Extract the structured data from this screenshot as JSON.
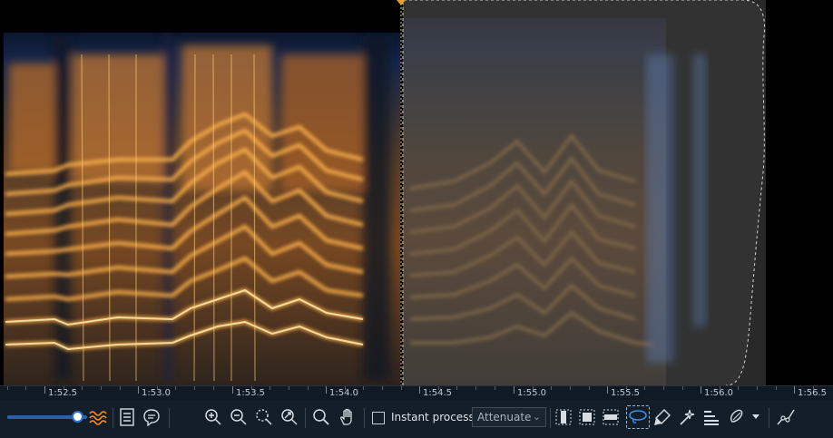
{
  "timeline": {
    "ticks": [
      "1:52.5",
      "1:53.0",
      "1:53.5",
      "1:54.0",
      "1:54.5",
      "1:55.0",
      "1:55.5",
      "1:56.0",
      "1:56.5"
    ]
  },
  "toolbar": {
    "zoom_level": 0.88,
    "instant_process_label": "Instant process",
    "instant_process_checked": false,
    "mode_select_value": "Attenuate",
    "icons": [
      "waveform-toggle-icon",
      "spectrum-list-icon",
      "comment-icon",
      "zoom-in-icon",
      "zoom-out-icon",
      "zoom-selection-icon",
      "zoom-fit-icon",
      "find-icon",
      "hand-icon",
      "time-selection-icon",
      "time-frequency-selection-icon",
      "frequency-selection-icon",
      "lasso-icon",
      "brush-icon",
      "magic-wand-icon",
      "harmonic-selection-icon",
      "paint-options-icon",
      "curve-icon"
    ]
  },
  "colors": {
    "background": "#000000",
    "panel": "#141e28",
    "accent": "#2b6fd0",
    "spectrogram_hot": "#ffcf6a",
    "spectrogram_cool": "#1b2d59",
    "selection_overlay": "#444444"
  }
}
